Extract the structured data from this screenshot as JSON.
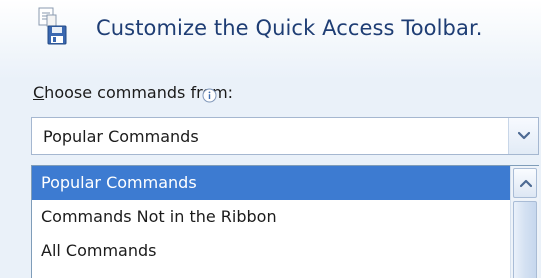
{
  "header": {
    "title": "Customize the Quick Access Toolbar.",
    "icon": "save-toolbar-icon"
  },
  "commands_from": {
    "label_hotkey": "C",
    "label_rest": "hoose commands from:",
    "info_icon": "info-icon"
  },
  "combo": {
    "selected": "Popular Commands",
    "button_icon": "chevron-down-icon"
  },
  "dropdown": {
    "items": [
      {
        "label": "Popular Commands",
        "selected": true
      },
      {
        "label": "Commands Not in the Ribbon",
        "selected": false
      },
      {
        "label": "All Commands",
        "selected": false
      }
    ],
    "scroll_up_icon": "chevron-up-icon"
  },
  "colors": {
    "title": "#1e3d74",
    "selection": "#3d7bd1",
    "border": "#a5b7d0",
    "background": "#eaf1f9"
  }
}
